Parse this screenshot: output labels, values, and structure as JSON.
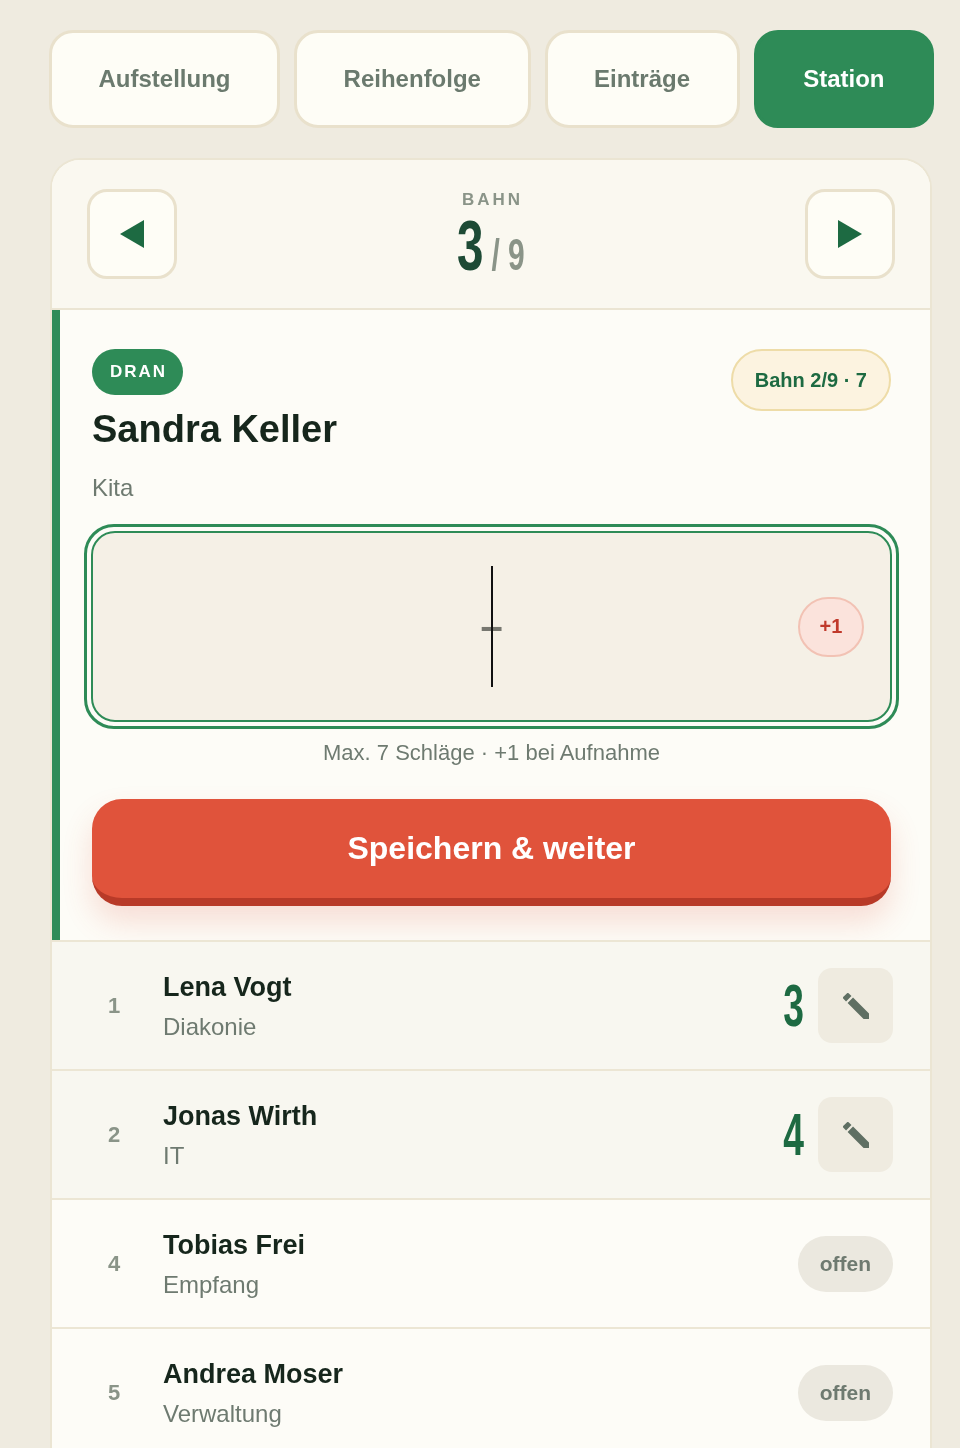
{
  "tabs": [
    {
      "label": "Aufstellung",
      "selected": false
    },
    {
      "label": "Reihenfolge",
      "selected": false
    },
    {
      "label": "Einträge",
      "selected": false
    },
    {
      "label": "Station",
      "selected": true
    }
  ],
  "lane_nav": {
    "label": "BAHN",
    "current": "3",
    "separator": "/",
    "total": "9"
  },
  "current_player": {
    "status": "DRAN",
    "name": "Sandra Keller",
    "team": "Kita",
    "progress_badge": "Bahn 2/9 · 7",
    "score_input": {
      "placeholder": "–",
      "focused": true,
      "bonus_button": "+1"
    },
    "hint": "Max. 7 Schläge · +1 bei Aufnahme",
    "save_button": "Speichern & weiter"
  },
  "players": [
    {
      "number": "1",
      "name": "Lena Vogt",
      "team": "Diakonie",
      "kind": "scored",
      "score": "3"
    },
    {
      "number": "2",
      "name": "Jonas Wirth",
      "team": "IT",
      "kind": "scored",
      "score": "4"
    },
    {
      "number": "4",
      "name": "Tobias Frei",
      "team": "Empfang",
      "kind": "open",
      "status": "offen"
    },
    {
      "number": "5",
      "name": "Andrea Moser",
      "team": "Verwaltung",
      "kind": "open",
      "status": "offen"
    }
  ]
}
